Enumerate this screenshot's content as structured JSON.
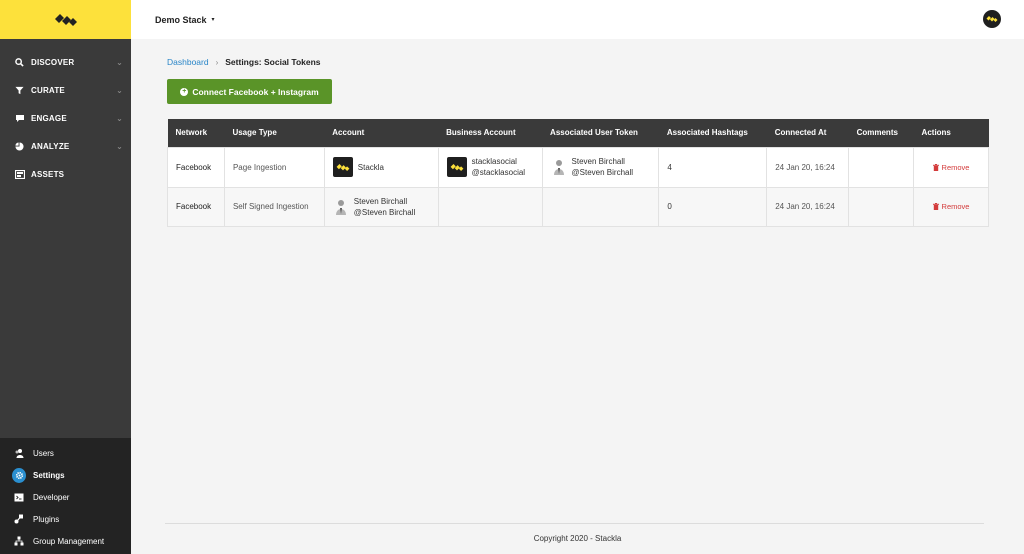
{
  "header": {
    "stack_name": "Demo Stack",
    "caret": "▾"
  },
  "sidebar": {
    "items": [
      {
        "label": "DISCOVER",
        "icon": "search-icon"
      },
      {
        "label": "CURATE",
        "icon": "filter-icon"
      },
      {
        "label": "ENGAGE",
        "icon": "chat-icon"
      },
      {
        "label": "ANALYZE",
        "icon": "pie-chart-icon"
      },
      {
        "label": "ASSETS",
        "icon": "image-icon"
      }
    ],
    "bottom_items": [
      {
        "label": "Users",
        "icon": "users-icon"
      },
      {
        "label": "Settings",
        "icon": "gear-icon"
      },
      {
        "label": "Developer",
        "icon": "code-icon"
      },
      {
        "label": "Plugins",
        "icon": "plugin-icon"
      },
      {
        "label": "Group Management",
        "icon": "hierarchy-icon"
      }
    ]
  },
  "breadcrumb": {
    "home": "Dashboard",
    "separator": "›",
    "current": "Settings: Social Tokens"
  },
  "connect_button": {
    "label": "Connect Facebook + Instagram"
  },
  "table": {
    "headers": [
      "Network",
      "Usage Type",
      "Account",
      "Business Account",
      "Associated User Token",
      "Associated Hashtags",
      "Connected At",
      "Comments",
      "Actions"
    ],
    "rows": [
      {
        "network": "Facebook",
        "usage_type": "Page Ingestion",
        "account": {
          "name": "Stackla"
        },
        "business_account": {
          "name": "stacklasocial",
          "handle": "@stacklasocial"
        },
        "user_token": {
          "name": "Steven Birchall",
          "handle": "@Steven Birchall"
        },
        "hashtags": "4",
        "connected_at": "24 Jan 20, 16:24",
        "comments": "",
        "action": "Remove"
      },
      {
        "network": "Facebook",
        "usage_type": "Self Signed Ingestion",
        "account": {
          "name": "Steven Birchall",
          "handle": "@Steven Birchall"
        },
        "business_account": {
          "name": "",
          "handle": ""
        },
        "user_token": {
          "name": "",
          "handle": ""
        },
        "hashtags": "0",
        "connected_at": "24 Jan 20, 16:24",
        "comments": "",
        "action": "Remove"
      }
    ]
  },
  "footer": {
    "copyright": "Copyright 2020 - Stackla"
  },
  "colors": {
    "brand_yellow": "#fde13b",
    "sidebar_bg": "#3a3a3a",
    "primary_green": "#5a9428",
    "link_blue": "#2a86c8",
    "danger_red": "#d33b3b"
  }
}
